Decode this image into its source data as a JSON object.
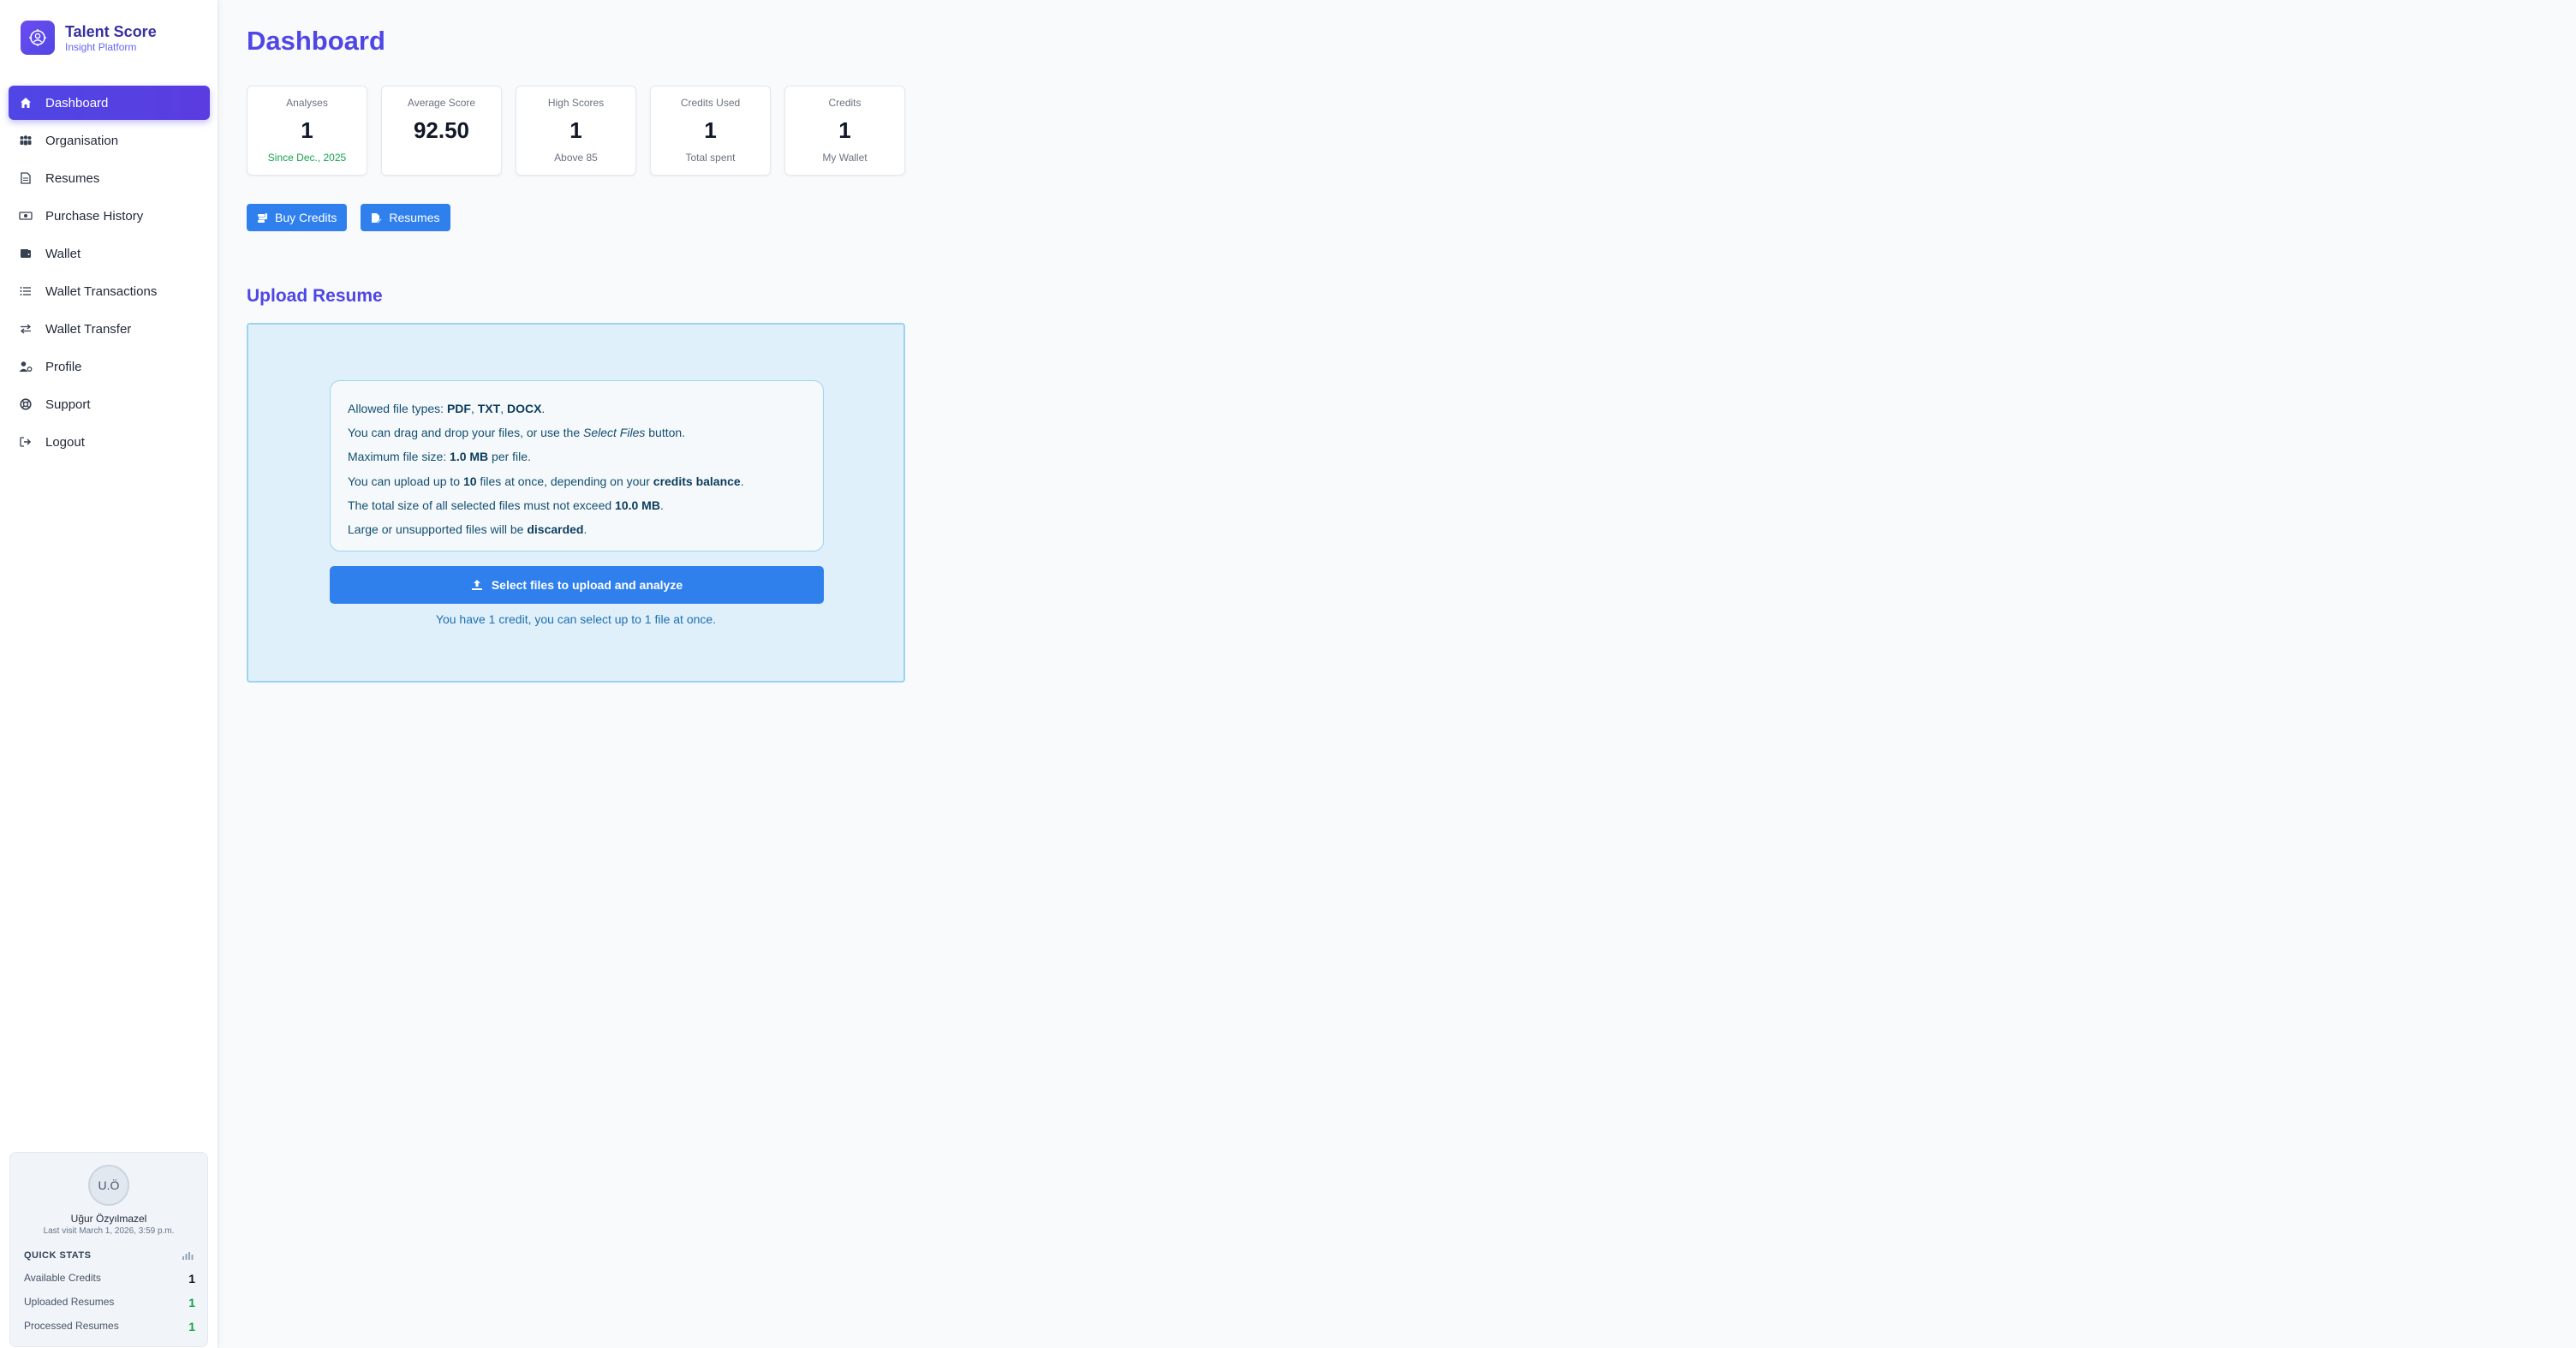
{
  "brand": {
    "title": "Talent Score",
    "subtitle": "Insight Platform"
  },
  "sidebar": {
    "items": [
      {
        "label": "Dashboard",
        "icon": "home-icon",
        "active": true
      },
      {
        "label": "Organisation",
        "icon": "users-icon"
      },
      {
        "label": "Resumes",
        "icon": "file-icon"
      },
      {
        "label": "Purchase History",
        "icon": "money-icon"
      },
      {
        "label": "Wallet",
        "icon": "wallet-icon"
      },
      {
        "label": "Wallet Transactions",
        "icon": "list-icon"
      },
      {
        "label": "Wallet Transfer",
        "icon": "transfer-icon"
      },
      {
        "label": "Profile",
        "icon": "user-gear-icon"
      },
      {
        "label": "Support",
        "icon": "lifebuoy-icon"
      },
      {
        "label": "Logout",
        "icon": "logout-icon"
      }
    ]
  },
  "user": {
    "initials": "U.Ö",
    "name": "Uğur Özyılmazel",
    "last_visit": "Last visit March 1, 2026, 3:59 p.m."
  },
  "quick_stats": {
    "title": "QUICK STATS",
    "rows": [
      {
        "label": "Available Credits",
        "value": "1",
        "color": "#111827"
      },
      {
        "label": "Uploaded Resumes",
        "value": "1",
        "color": "#16a34a"
      },
      {
        "label": "Processed Resumes",
        "value": "1",
        "color": "#16a34a"
      }
    ]
  },
  "page": {
    "title": "Dashboard"
  },
  "stats": [
    {
      "label": "Analyses",
      "value": "1",
      "sub": "Since Dec., 2025",
      "sub_color": "green"
    },
    {
      "label": "Average Score",
      "value": "92.50",
      "sub": ""
    },
    {
      "label": "High Scores",
      "value": "1",
      "sub": "Above 85"
    },
    {
      "label": "Credits Used",
      "value": "1",
      "sub": "Total spent"
    },
    {
      "label": "Credits",
      "value": "1",
      "sub": "My Wallet"
    }
  ],
  "actions": {
    "buy_credits": "Buy Credits",
    "resumes": "Resumes"
  },
  "upload": {
    "title": "Upload Resume",
    "select_button": "Select files to upload and analyze",
    "credit_note": "You have 1 credit, you can select up to 1 file at once.",
    "info": {
      "l1_pre": "Allowed file types: ",
      "l1_pdf": "PDF",
      "l1_c1": ", ",
      "l1_txt": "TXT",
      "l1_c2": ", ",
      "l1_docx": "DOCX",
      "l1_end": ".",
      "l2_pre": "You can drag and drop your files, or use the ",
      "l2_em": "Select Files",
      "l2_end": " button.",
      "l3_pre": "Maximum file size: ",
      "l3_b": "1.0 MB",
      "l3_end": " per file.",
      "l4_pre": "You can upload up to ",
      "l4_b": "10",
      "l4_mid": " files at once, depending on your ",
      "l4_b2": "credits balance",
      "l4_end": ".",
      "l5_pre": "The total size of all selected files must not exceed ",
      "l5_b": "10.0 MB",
      "l5_end": ".",
      "l6_pre": "Large or unsupported files will be ",
      "l6_b": "discarded",
      "l6_end": "."
    }
  },
  "colors": {
    "accent": "#4f46e5",
    "button": "#2f80ed",
    "upload_bg": "#e0f0fb",
    "success": "#16a34a"
  }
}
